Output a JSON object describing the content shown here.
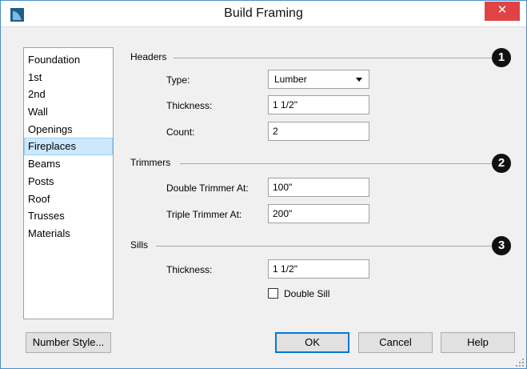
{
  "window": {
    "title": "Build Framing",
    "close_glyph": "✕"
  },
  "sidebar": {
    "items": [
      {
        "label": "Foundation"
      },
      {
        "label": "1st"
      },
      {
        "label": "2nd"
      },
      {
        "label": "Wall"
      },
      {
        "label": "Openings"
      },
      {
        "label": "Fireplaces",
        "selected": true
      },
      {
        "label": "Beams"
      },
      {
        "label": "Posts"
      },
      {
        "label": "Roof"
      },
      {
        "label": "Trusses"
      },
      {
        "label": "Materials"
      }
    ]
  },
  "headers": {
    "title": "Headers",
    "badge": "1",
    "type_label": "Type:",
    "type_value": "Lumber",
    "thickness_label": "Thickness:",
    "thickness_value": "1 1/2\"",
    "count_label": "Count:",
    "count_value": "2"
  },
  "trimmers": {
    "title": "Trimmers",
    "badge": "2",
    "double_label": "Double Trimmer At:",
    "double_value": "100\"",
    "triple_label": "Triple Trimmer At:",
    "triple_value": "200\""
  },
  "sills": {
    "title": "Sills",
    "badge": "3",
    "thickness_label": "Thickness:",
    "thickness_value": "1 1/2\"",
    "double_sill_label": "Double Sill",
    "double_sill_checked": false
  },
  "buttons": {
    "number_style": "Number Style...",
    "ok": "OK",
    "cancel": "Cancel",
    "help": "Help"
  },
  "colors": {
    "close_bg": "#e04343",
    "selection_bg": "#cce8ff",
    "accent": "#0078d7"
  }
}
